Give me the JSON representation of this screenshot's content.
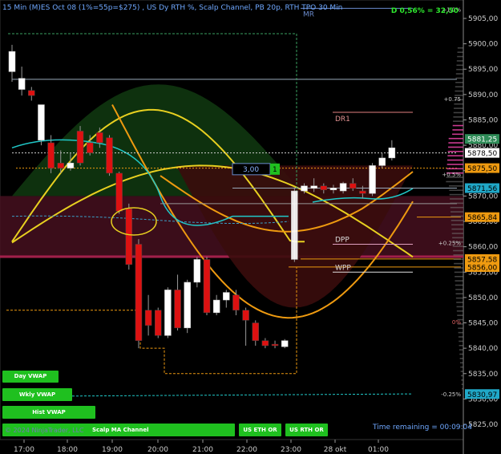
{
  "header": {
    "title": "15 Min (M)ES Oct 08 (1%=55p=$275) , US Dy RTH %, Scalp Channel, PB 20p, RTH TPO 30 Min",
    "pnl": "D 0,56% = 32,50",
    "mr_label": "MR"
  },
  "footer": {
    "copyright": "© 2024 NinjaTrader, LLC",
    "time_remaining": "Time remaining = 00:09:04"
  },
  "buttons": [
    {
      "id": "day-vwap",
      "label": "Day VWAP"
    },
    {
      "id": "wkly-vwap",
      "label": "Wkly VWAP"
    },
    {
      "id": "hist-vwap",
      "label": "Hist VWAP"
    },
    {
      "id": "scalp-ma-channel",
      "label": "Scalp MA Channel"
    },
    {
      "id": "us-eth-or",
      "label": "US ETH OR"
    },
    {
      "id": "us-rth-or",
      "label": "US RTH OR"
    }
  ],
  "colors": {
    "up": "#ffffff",
    "down": "#dd1111",
    "cyan": "#20c8c8",
    "yellow": "#e8d020",
    "orange": "#ee9a10",
    "accent": "#1fc01f",
    "price_box_green": "#2e8b57"
  },
  "chart_data": {
    "type": "candlestick",
    "ylim": [
      5822,
      5908
    ],
    "y_ticks": [
      5825,
      5830,
      5835,
      5840,
      5845,
      5850,
      5855,
      5860,
      5865,
      5870,
      5875,
      5880,
      5885,
      5890,
      5895,
      5900,
      5905
    ],
    "x_ticks": [
      "17:00",
      "18:00",
      "19:00",
      "20:00",
      "21:00",
      "22:00",
      "23:00",
      "28 okt",
      "01:00"
    ],
    "candles": [
      {
        "o": 5894.5,
        "h": 5899.8,
        "l": 5892.5,
        "c": 5898.5
      },
      {
        "o": 5891.0,
        "h": 5895.5,
        "l": 5889.8,
        "c": 5893.2
      },
      {
        "o": 5890.8,
        "h": 5891.5,
        "l": 5888.8,
        "c": 5889.8
      },
      {
        "o": 5881.0,
        "h": 5888.0,
        "l": 5880.0,
        "c": 5888.0
      },
      {
        "o": 5880.5,
        "h": 5882.0,
        "l": 5874.5,
        "c": 5875.5
      },
      {
        "o": 5876.5,
        "h": 5879.0,
        "l": 5874.5,
        "c": 5875.5
      },
      {
        "o": 5875.5,
        "h": 5878.5,
        "l": 5875.0,
        "c": 5876.5
      },
      {
        "o": 5882.8,
        "h": 5883.8,
        "l": 5876.0,
        "c": 5876.5
      },
      {
        "o": 5880.5,
        "h": 5882.0,
        "l": 5878.0,
        "c": 5878.5
      },
      {
        "o": 5882.5,
        "h": 5883.5,
        "l": 5879.5,
        "c": 5880.5
      },
      {
        "o": 5881.5,
        "h": 5882.0,
        "l": 5874.0,
        "c": 5874.5
      },
      {
        "o": 5874.5,
        "h": 5874.8,
        "l": 5866.5,
        "c": 5867.0
      },
      {
        "o": 5867.5,
        "h": 5868.5,
        "l": 5855.5,
        "c": 5856.5
      },
      {
        "o": 5860.5,
        "h": 5861.5,
        "l": 5840.0,
        "c": 5841.5
      },
      {
        "o": 5847.5,
        "h": 5850.5,
        "l": 5842.5,
        "c": 5844.5
      },
      {
        "o": 5847.5,
        "h": 5848.0,
        "l": 5842.0,
        "c": 5842.5
      },
      {
        "o": 5842.5,
        "h": 5852.0,
        "l": 5842.0,
        "c": 5851.5
      },
      {
        "o": 5851.5,
        "h": 5854.5,
        "l": 5843.5,
        "c": 5844.0
      },
      {
        "o": 5844.0,
        "h": 5853.5,
        "l": 5843.0,
        "c": 5853.0
      },
      {
        "o": 5853.0,
        "h": 5858.0,
        "l": 5852.0,
        "c": 5857.5
      },
      {
        "o": 5857.5,
        "h": 5858.0,
        "l": 5846.5,
        "c": 5847.0
      },
      {
        "o": 5847.0,
        "h": 5850.5,
        "l": 5846.5,
        "c": 5849.5
      },
      {
        "o": 5849.5,
        "h": 5851.5,
        "l": 5848.0,
        "c": 5851.0
      },
      {
        "o": 5850.5,
        "h": 5851.5,
        "l": 5846.5,
        "c": 5847.5
      },
      {
        "o": 5847.5,
        "h": 5848.0,
        "l": 5840.5,
        "c": 5845.5
      },
      {
        "o": 5845.0,
        "h": 5845.5,
        "l": 5840.5,
        "c": 5841.5
      },
      {
        "o": 5841.5,
        "h": 5842.0,
        "l": 5840.0,
        "c": 5840.5
      },
      {
        "o": 5840.8,
        "h": 5841.5,
        "l": 5840.0,
        "c": 5840.5
      },
      {
        "o": 5840.3,
        "h": 5841.8,
        "l": 5840.0,
        "c": 5841.5
      },
      {
        "o": 5857.5,
        "h": 5871.5,
        "l": 5857.0,
        "c": 5871.0
      },
      {
        "o": 5871.0,
        "h": 5872.5,
        "l": 5870.5,
        "c": 5872.0
      },
      {
        "o": 5871.5,
        "h": 5873.5,
        "l": 5870.8,
        "c": 5872.0
      },
      {
        "o": 5872.0,
        "h": 5872.5,
        "l": 5870.5,
        "c": 5871.2
      },
      {
        "o": 5871.2,
        "h": 5872.2,
        "l": 5870.5,
        "c": 5871.6
      },
      {
        "o": 5871.0,
        "h": 5872.8,
        "l": 5870.5,
        "c": 5872.5
      },
      {
        "o": 5872.5,
        "h": 5873.5,
        "l": 5871.0,
        "c": 5871.5
      },
      {
        "o": 5871.0,
        "h": 5872.0,
        "l": 5869.5,
        "c": 5870.5
      },
      {
        "o": 5870.5,
        "h": 5876.5,
        "l": 5870.0,
        "c": 5876.0
      },
      {
        "o": 5876.0,
        "h": 5878.5,
        "l": 5875.5,
        "c": 5877.5
      },
      {
        "o": 5877.5,
        "h": 5881.0,
        "l": 5877.0,
        "c": 5879.5
      }
    ],
    "price_labels": [
      {
        "value": 5881.25,
        "text": "5881,25",
        "style": "green"
      },
      {
        "value": 5878.5,
        "text": "5878,50",
        "style": "white"
      },
      {
        "value": 5875.5,
        "text": "5875,50",
        "style": "orange"
      },
      {
        "value": 5871.56,
        "text": "5871,56",
        "style": "cyan"
      },
      {
        "value": 5865.84,
        "text": "5865,84",
        "style": "orange"
      },
      {
        "value": 5857.58,
        "text": "5857,58",
        "style": "orange"
      },
      {
        "value": 5856.0,
        "text": "5856,00",
        "style": "orange"
      },
      {
        "value": 5830.97,
        "text": "5830,97",
        "style": "cyan"
      }
    ],
    "pct_labels": [
      {
        "value": 5906.8,
        "text": "+1.0%"
      },
      {
        "value": 5889.2,
        "text": "+0.75"
      },
      {
        "value": 5874.3,
        "text": "+0.5%"
      },
      {
        "value": 5860.8,
        "text": "+0.25%"
      },
      {
        "value": 5845.2,
        "text": "0%"
      },
      {
        "value": 5831.0,
        "text": "-0.25%"
      }
    ],
    "levels": [
      {
        "name": "DR1",
        "value": 5886.5
      },
      {
        "name": "DPP",
        "value": 5860.5
      },
      {
        "name": "WPP",
        "value": 5855.0
      }
    ],
    "order": {
      "qty": "3,00",
      "count": "1",
      "value": 5875.3
    }
  }
}
